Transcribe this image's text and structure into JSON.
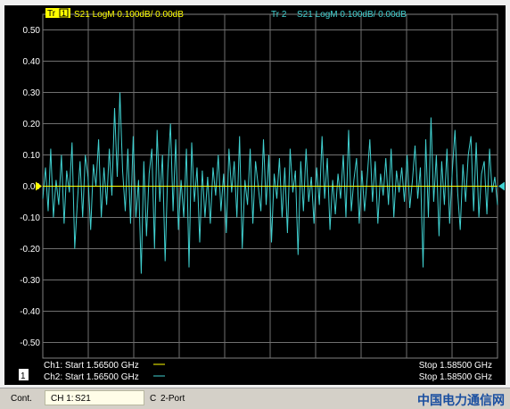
{
  "traces": {
    "tr1": {
      "tag": "Tr",
      "num": "1",
      "desc": "S21 LogM 0.100dB/  0.00dB",
      "color": "#ffff00"
    },
    "tr2": {
      "tag": "Tr  2",
      "desc": "S21 LogM 0.100dB/  0.00dB",
      "color": "#40d0d0"
    }
  },
  "channel_badge": "1",
  "footer": {
    "ch1_start": "Ch1: Start  1.56500 GHz",
    "ch2_start": "Ch2: Start  1.56500 GHz",
    "ch1_stop": "Stop  1.58500 GHz",
    "ch2_stop": "Stop  1.58500 GHz"
  },
  "status_bar": {
    "cont": "Cont.",
    "channel": "CH 1:",
    "param": "S21",
    "mode": "C",
    "port": "2-Port"
  },
  "watermark": "中国电力通信网",
  "chart_data": {
    "type": "line",
    "ylim": [
      -0.55,
      0.55
    ],
    "yticks": [
      "0.50",
      "0.40",
      "0.30",
      "0.20",
      "0.10",
      "0.00",
      "-0.10",
      "-0.20",
      "-0.30",
      "-0.40",
      "-0.50"
    ],
    "xlim": [
      1.565,
      1.585
    ],
    "x_unit": "GHz",
    "grid": true,
    "reference_level": 0.0,
    "series": [
      {
        "trace": "Tr 1",
        "color": "#ffff00",
        "values": [
          0.0,
          0.0
        ]
      },
      {
        "trace": "Tr 2",
        "color": "#40d0d0",
        "values": [
          -0.04,
          0.06,
          -0.08,
          0.12,
          -0.1,
          0.02,
          -0.06,
          0.1,
          -0.12,
          0.05,
          -0.02,
          0.14,
          -0.2,
          -0.05,
          0.08,
          -0.1,
          0.1,
          0.03,
          -0.14,
          0.07,
          0.0,
          0.15,
          -0.1,
          0.06,
          -0.06,
          0.12,
          -0.03,
          0.25,
          0.03,
          0.3,
          0.05,
          -0.08,
          0.12,
          -0.12,
          0.16,
          -0.1,
          0.02,
          -0.28,
          0.08,
          -0.16,
          0.04,
          0.12,
          -0.2,
          0.18,
          -0.05,
          0.1,
          -0.24,
          0.05,
          0.2,
          -0.08,
          0.15,
          -0.14,
          0.02,
          -0.1,
          0.12,
          -0.26,
          0.14,
          -0.05,
          0.06,
          -0.18,
          0.05,
          -0.1,
          0.03,
          -0.12,
          0.06,
          -0.03,
          0.1,
          -0.08,
          0.04,
          -0.15,
          0.12,
          -0.02,
          0.08,
          -0.1,
          0.16,
          -0.2,
          0.02,
          -0.06,
          0.12,
          -0.12,
          0.08,
          0.0,
          -0.08,
          0.15,
          -0.06,
          0.1,
          -0.18,
          0.04,
          -0.04,
          0.09,
          -0.1,
          0.06,
          -0.15,
          0.12,
          -0.02,
          0.05,
          -0.22,
          0.08,
          -0.08,
          0.12,
          -0.05,
          0.03,
          -0.12,
          0.06,
          -0.06,
          0.16,
          -0.04,
          0.09,
          -0.14,
          0.02,
          -0.09,
          0.04,
          -0.04,
          0.1,
          -0.1,
          0.18,
          -0.08,
          0.02,
          0.09,
          -0.12,
          0.05,
          -0.08,
          0.03,
          0.15,
          -0.05,
          0.08,
          -0.12,
          0.04,
          -0.03,
          0.09,
          -0.06,
          0.12,
          -0.1,
          0.05,
          -0.02,
          0.06,
          -0.05,
          0.1,
          -0.07,
          0.02,
          0.13,
          -0.04,
          0.06,
          -0.26,
          0.15,
          -0.1,
          0.22,
          -0.05,
          0.1,
          -0.16,
          0.08,
          -0.06,
          0.12,
          -0.12,
          0.05,
          0.18,
          -0.02,
          -0.14,
          0.07,
          -0.05,
          0.1,
          0.16,
          -0.08,
          0.14,
          -0.1,
          0.04,
          0.08,
          -0.09,
          0.12,
          -0.02,
          0.03,
          -0.06
        ]
      }
    ]
  }
}
